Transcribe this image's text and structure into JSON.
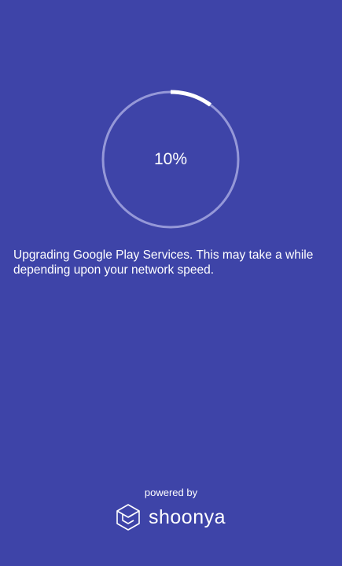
{
  "progress": {
    "value": 0.1,
    "label": "10%"
  },
  "message": "Upgrading Google Play Services. This may take a while depending upon your network speed.",
  "footer": {
    "powered_by": "powered by",
    "brand_name": "shoonya",
    "logo_icon": "shoonya-logo-icon"
  },
  "colors": {
    "background": "#3e44a8",
    "track": "#9598d8",
    "progress": "#ffffff",
    "text": "#ffffff"
  }
}
